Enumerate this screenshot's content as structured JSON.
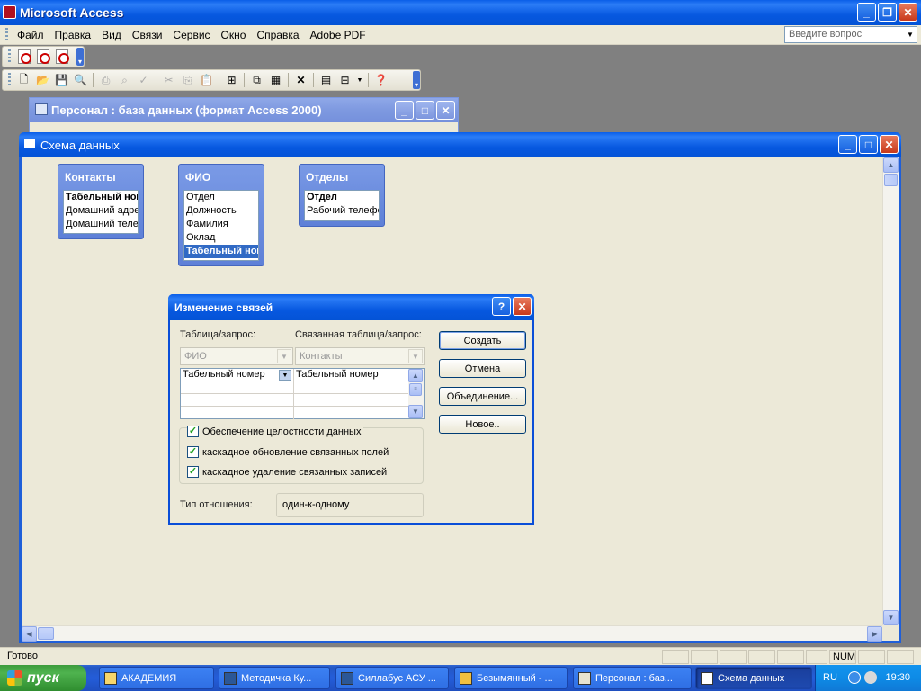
{
  "app": {
    "title": "Microsoft Access"
  },
  "menu": {
    "items": [
      "Файл",
      "Правка",
      "Вид",
      "Связи",
      "Сервис",
      "Окно",
      "Справка",
      "Adobe PDF"
    ],
    "ask_placeholder": "Введите вопрос"
  },
  "db_window": {
    "title": "Персонал : база данных (формат Access 2000)"
  },
  "schema_window": {
    "title": "Схема данных"
  },
  "tables": [
    {
      "name": "Контакты",
      "fields": [
        "Табельный номер",
        "Домашний адрес",
        "Домашний телефон"
      ],
      "key_index": 0
    },
    {
      "name": "ФИО",
      "fields": [
        "Отдел",
        "Должность",
        "Фамилия",
        "Оклад",
        "Табельный номер"
      ],
      "selected_index": 4
    },
    {
      "name": "Отделы",
      "fields": [
        "Отдел",
        "Рабочий телефон"
      ],
      "key_index": 0
    }
  ],
  "dialog": {
    "title": "Изменение связей",
    "table_label": "Таблица/запрос:",
    "related_label": "Связанная таблица/запрос:",
    "table_value": "ФИО",
    "related_value": "Контакты",
    "grid_rows": [
      {
        "left": "Табельный номер",
        "right": "Табельный номер"
      }
    ],
    "buttons": {
      "create": "Создать",
      "cancel": "Отмена",
      "join": "Объединение...",
      "new": "Новое.."
    },
    "checks": {
      "integrity": "Обеспечение целостности данных",
      "cascade_update": "каскадное обновление связанных полей",
      "cascade_delete": "каскадное удаление связанных записей"
    },
    "relation_type_label": "Тип отношения:",
    "relation_type_value": "один-к-одному"
  },
  "status": {
    "ready": "Готово",
    "num": "NUM"
  },
  "taskbar": {
    "start": "пуск",
    "tasks": [
      "АКАДЕМИЯ",
      "Методичка Ку...",
      "Силлабус АСУ ...",
      "Безымянный - ...",
      "Персонал : баз...",
      "Схема данных"
    ],
    "lang": "RU",
    "clock": "19:30"
  }
}
